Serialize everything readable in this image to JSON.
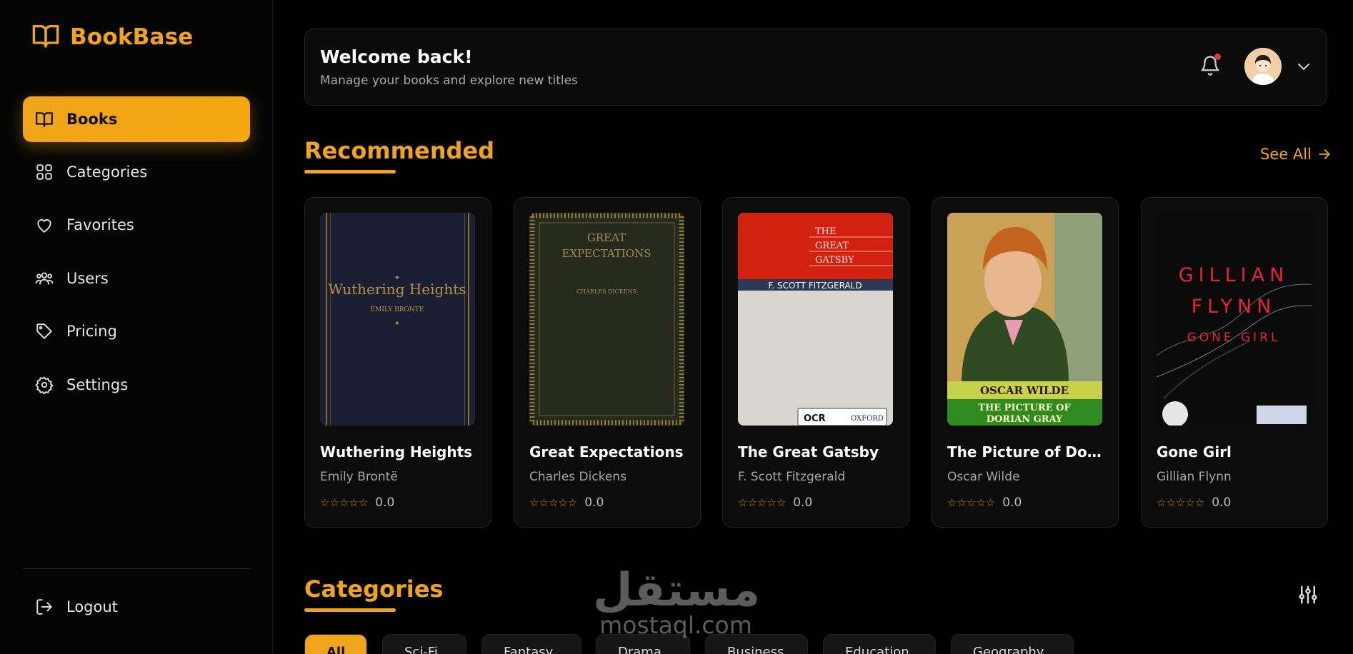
{
  "app": {
    "name": "BookBase",
    "accent": "#f0a419"
  },
  "sidebar": {
    "items": [
      {
        "label": "Books",
        "icon": "book-open-icon",
        "active": true
      },
      {
        "label": "Categories",
        "icon": "grid-icon",
        "active": false
      },
      {
        "label": "Favorites",
        "icon": "heart-icon",
        "active": false
      },
      {
        "label": "Users",
        "icon": "users-icon",
        "active": false
      },
      {
        "label": "Pricing",
        "icon": "tag-icon",
        "active": false
      },
      {
        "label": "Settings",
        "icon": "gear-icon",
        "active": false
      }
    ],
    "logout": {
      "label": "Logout",
      "icon": "logout-icon"
    }
  },
  "header": {
    "title": "Welcome back!",
    "subtitle": "Manage your books and explore new titles",
    "notification_indicator": true
  },
  "recommended": {
    "title": "Recommended",
    "see_all": "See All",
    "books": [
      {
        "title": "Wuthering Heights",
        "author": "Emily Brontë",
        "rating": "0.0",
        "cover_text": [
          "Wuthering Heights",
          "EMILY BRONTE"
        ]
      },
      {
        "title": "Great Expectations",
        "author": "Charles Dickens",
        "rating": "0.0",
        "cover_text": [
          "GREAT",
          "EXPECTATIONS",
          "CHARLES DICKENS"
        ]
      },
      {
        "title": "The Great Gatsby",
        "author": "F. Scott Fitzgerald",
        "rating": "0.0",
        "cover_text": [
          "THE",
          "GREAT",
          "GATSBY",
          "F. SCOTT FITZGERALD",
          "OCR",
          "OXFORD"
        ]
      },
      {
        "title": "The Picture of Doria...",
        "author": "Oscar Wilde",
        "rating": "0.0",
        "cover_text": [
          "OSCAR WILDE",
          "THE PICTURE OF",
          "DORIAN GRAY"
        ]
      },
      {
        "title": "Gone Girl",
        "author": "Gillian Flynn",
        "rating": "0.0",
        "cover_text": [
          "GILLIAN",
          "FLYNN",
          "GONE GIRL"
        ]
      }
    ]
  },
  "categories": {
    "title": "Categories",
    "pills": [
      "All",
      "Sci-Fi",
      "Fantasy",
      "Drama",
      "Business",
      "Education",
      "Geography"
    ],
    "active_pill": "All"
  },
  "watermark": {
    "arabic": "مستقل",
    "latin": "mostaql.com"
  }
}
